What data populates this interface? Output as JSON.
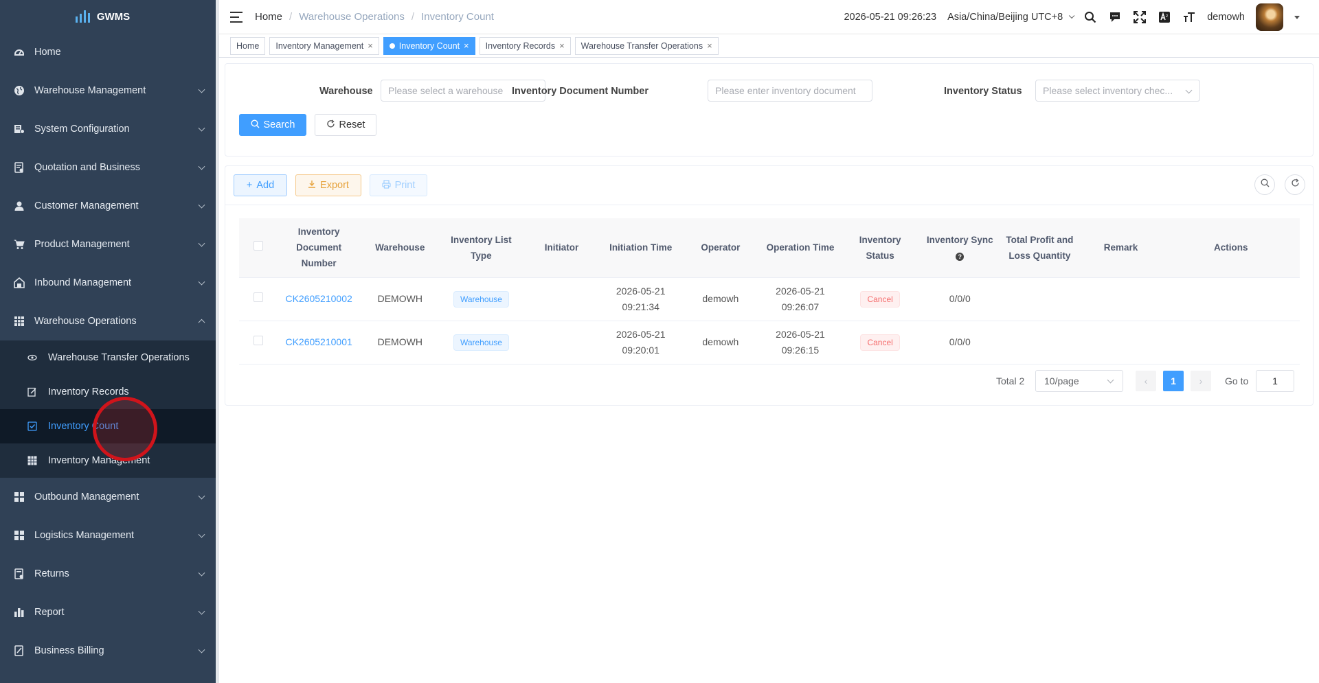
{
  "app": {
    "name": "GWMS"
  },
  "sidebar": {
    "items": [
      {
        "label": "Home",
        "icon": "dashboard-icon"
      },
      {
        "label": "Warehouse Management",
        "icon": "globe-icon"
      },
      {
        "label": "System Configuration",
        "icon": "config-icon"
      },
      {
        "label": "Quotation and Business",
        "icon": "quotation-icon"
      },
      {
        "label": "Customer Management",
        "icon": "user-icon"
      },
      {
        "label": "Product Management",
        "icon": "cart-icon"
      },
      {
        "label": "Inbound Management",
        "icon": "inbound-icon"
      },
      {
        "label": "Warehouse Operations",
        "icon": "grid-icon"
      },
      {
        "label": "Outbound Management",
        "icon": "apps-icon"
      },
      {
        "label": "Logistics Management",
        "icon": "apps-icon"
      },
      {
        "label": "Returns",
        "icon": "returns-icon"
      },
      {
        "label": "Report",
        "icon": "bar-chart-icon"
      },
      {
        "label": "Business Billing",
        "icon": "billing-icon"
      }
    ],
    "submenu": [
      {
        "label": "Warehouse Transfer Operations"
      },
      {
        "label": "Inventory Records"
      },
      {
        "label": "Inventory Count"
      },
      {
        "label": "Inventory Management"
      }
    ]
  },
  "header": {
    "breadcrumb": [
      "Home",
      "Warehouse Operations",
      "Inventory Count"
    ],
    "datetime": "2026-05-21 09:26:23",
    "timezone": "Asia/China/Beijing UTC+8",
    "username": "demowh"
  },
  "tags": [
    {
      "label": "Home"
    },
    {
      "label": "Inventory Management"
    },
    {
      "label": "Inventory Count"
    },
    {
      "label": "Inventory Records"
    },
    {
      "label": "Warehouse Transfer Operations"
    }
  ],
  "search": {
    "warehouse_label": "Warehouse",
    "warehouse_placeholder": "Please select a warehouse",
    "docnum_label": "Inventory Document Number",
    "docnum_placeholder": "Please enter inventory document",
    "status_label": "Inventory Status",
    "status_placeholder": "Please select inventory chec...",
    "search_btn": "Search",
    "reset_btn": "Reset"
  },
  "toolbar": {
    "add": "Add",
    "export": "Export",
    "print": "Print"
  },
  "table": {
    "headers": {
      "docnum": "Inventory Document Number",
      "warehouse": "Warehouse",
      "list_type": "Inventory List Type",
      "initiator": "Initiator",
      "init_time": "Initiation Time",
      "operator": "Operator",
      "op_time": "Operation Time",
      "status": "Inventory Status",
      "sync": "Inventory Sync",
      "profit": "Total Profit and Loss Quantity",
      "remark": "Remark",
      "actions": "Actions"
    },
    "rows": [
      {
        "docnum": "CK2605210002",
        "warehouse": "DEMOWH",
        "list_type": "Warehouse",
        "initiator": "",
        "init_date": "2026-05-21",
        "init_clock": "09:21:34",
        "operator": "demowh",
        "op_date": "2026-05-21",
        "op_clock": "09:26:07",
        "status": "Cancel",
        "sync": "0/0/0",
        "profit": "",
        "remark": ""
      },
      {
        "docnum": "CK2605210001",
        "warehouse": "DEMOWH",
        "list_type": "Warehouse",
        "initiator": "",
        "init_date": "2026-05-21",
        "init_clock": "09:20:01",
        "operator": "demowh",
        "op_date": "2026-05-21",
        "op_clock": "09:26:15",
        "status": "Cancel",
        "sync": "0/0/0",
        "profit": "",
        "remark": ""
      }
    ]
  },
  "pagination": {
    "total": "Total 2",
    "page_size": "10/page",
    "current": "1",
    "goto_label": "Go to",
    "goto_value": "1"
  }
}
